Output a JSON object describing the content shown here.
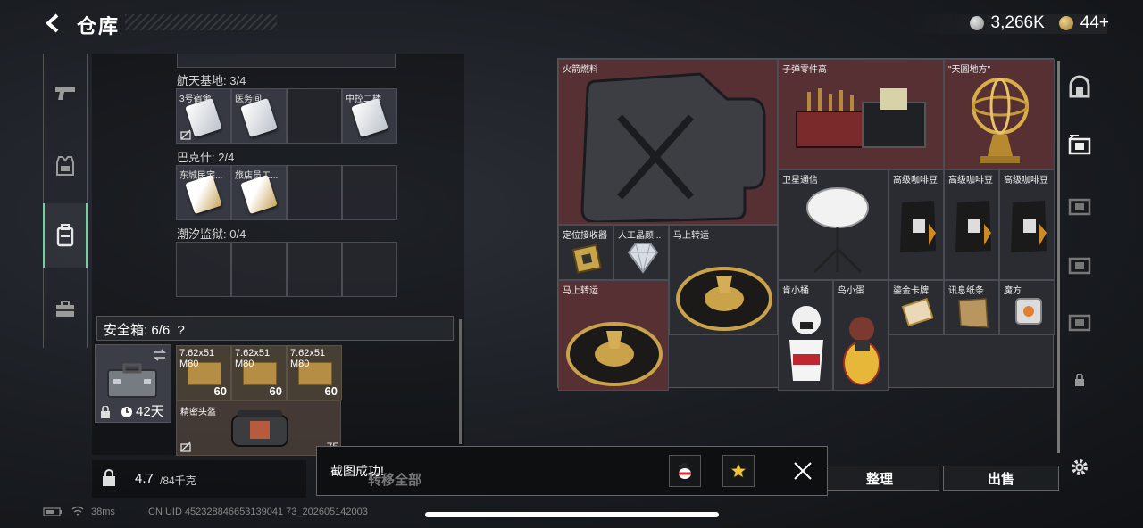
{
  "header": {
    "title": "仓库",
    "currency1": "3,266K",
    "currency2": "44+"
  },
  "left_panel": {
    "sections": [
      {
        "label": "航天基地: 3/4",
        "slots": [
          "3号宿舍",
          "医务间",
          "",
          "中控二楼"
        ]
      },
      {
        "label": "巴克什: 2/4",
        "slots": [
          "东城民宅...",
          "旅店员工...",
          "",
          ""
        ]
      },
      {
        "label": "潮汐监狱: 0/4",
        "slots": [
          "",
          "",
          "",
          ""
        ]
      }
    ],
    "secure": {
      "label": "安全箱: 6/6",
      "help": "?",
      "timer": "42天"
    },
    "ammo": [
      {
        "name": "7.62x51\nM80",
        "count": "60"
      },
      {
        "name": "7.62x51\nM80",
        "count": "60"
      },
      {
        "name": "7.62x51\nM80",
        "count": "60"
      }
    ],
    "helmet": {
      "name": "精密头盔",
      "count": "75"
    },
    "weight": {
      "value": "4.7",
      "max": "/84千克"
    }
  },
  "grid_items": {
    "rocket_fuel": "火箭燃料",
    "ammo_parts": "子弹零件高",
    "heaven_earth": "\"天圆地方\"",
    "satellite": "卫星通信",
    "coffee1": "高级咖啡豆",
    "coffee2": "高级咖啡豆",
    "coffee3": "高级咖啡豆",
    "locator": "定位接收器",
    "diamond": "人工晶颜...",
    "turntable1": "马上转运",
    "turntable2": "马上转运",
    "kfc": "肯小桶",
    "egg": "鸟小蛋",
    "gold_card": "鎏金卡牌",
    "paper": "讯息纸条",
    "cube": "魔方"
  },
  "buttons": {
    "sort": "整理",
    "sell": "出售",
    "transfer_all": "转移全部"
  },
  "toast": {
    "message": "截图成功!"
  },
  "status": {
    "ping": "38ms",
    "uid": "CN UID 452328846653139041 73_202605142003"
  }
}
